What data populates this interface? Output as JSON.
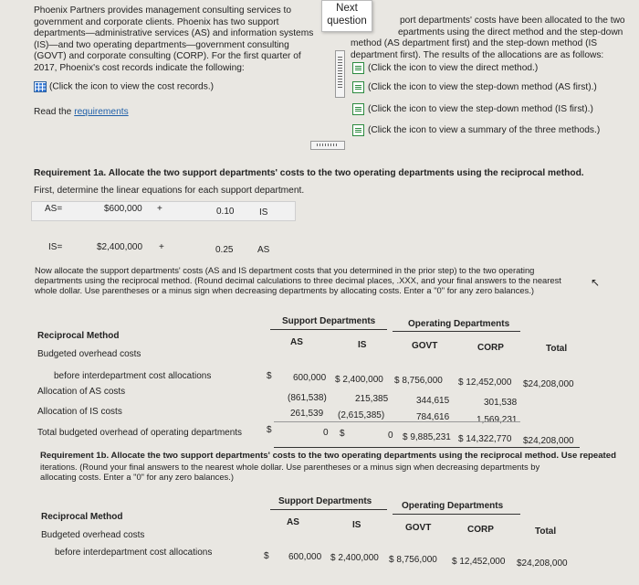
{
  "intro": {
    "left_lines": [
      "Phoenix Partners provides management consulting services to",
      "government and corporate clients. Phoenix has two support",
      "departments—administrative services (AS) and information systems",
      "(IS)—and two operating departments—government consulting",
      "(GOVT) and corporate consulting (CORP). For the first quarter of",
      "2017, Phoenix's cost records indicate the following:"
    ],
    "cost_records_link": "(Click the icon to view the cost records.)",
    "read_the": "Read the",
    "requirements_link": "requirements",
    "right_lines": [
      "port departments' costs have been allocated to the two",
      "epartments using the direct method and the step-down",
      "method (AS department first) and the step-down method (IS",
      "department first). The results of the allocations are as follows:"
    ],
    "links": [
      "(Click the icon to view the direct method.)",
      "(Click the icon to view the step-down method (AS first).)",
      "(Click the icon to view the step-down method (IS first).)",
      "(Click the icon to view a summary of the three methods.)"
    ]
  },
  "next_question": {
    "line1": "Next",
    "line2": "question"
  },
  "req1a": {
    "title": "Requirement 1a. Allocate the two support departments' costs to the two operating departments using the reciprocal method.",
    "subtitle": "First, determine the linear equations for each support department.",
    "eq_as": {
      "label": "AS=",
      "amount": "$600,000",
      "plus": "+",
      "coef": "0.10",
      "var": "IS"
    },
    "eq_is": {
      "label": "IS=",
      "amount": "$2,400,000",
      "plus": "+",
      "coef": "0.25",
      "var": "AS"
    },
    "instructions": [
      "Now allocate the support departments' costs (AS and IS department costs that you determined in the prior step) to the two operating",
      "departments using the reciprocal method. (Round decimal calculations to three decimal places, .XXX, and your final answers to the nearest",
      "whole dollar. Use parentheses or a minus sign when decreasing departments by allocating costs. Enter a \"0\" for any zero balances.)"
    ]
  },
  "table1": {
    "group_support": "Support Departments",
    "group_operating": "Operating Departments",
    "method": "Reciprocal Method",
    "cols": [
      "AS",
      "IS",
      "GOVT",
      "CORP",
      "Total"
    ],
    "rows": [
      {
        "label": "Budgeted overhead costs",
        "cells": [
          "",
          "",
          "",
          "",
          ""
        ]
      },
      {
        "label": "before interdepartment cost allocations",
        "dollar": "$",
        "cells": [
          "600,000",
          "$ 2,400,000",
          "$ 8,756,000",
          "$ 12,452,000",
          "$24,208,000"
        ]
      },
      {
        "label": "Allocation of AS costs",
        "cells": [
          "(861,538)",
          "215,385",
          "344,615",
          "301,538",
          ""
        ]
      },
      {
        "label": "Allocation of IS costs",
        "cells": [
          "261,539",
          "(2,615,385)",
          "784,616",
          "1,569,231",
          ""
        ]
      },
      {
        "label": "Total budgeted overhead of operating departments",
        "dollar": "$",
        "cells": [
          "0",
          "$",
          "0",
          "$ 9,885,231",
          "$ 14,322,770",
          "$24,208,000"
        ]
      }
    ]
  },
  "req1b": {
    "title": "Requirement 1b. Allocate the two support departments' costs to the two operating departments using the reciprocal method. Use repeated",
    "lines": [
      "iterations. (Round your final answers to the nearest whole dollar. Use parentheses or a minus sign when decreasing departments by",
      "allocating costs. Enter a \"0\" for any zero balances.)"
    ]
  },
  "table2": {
    "group_support": "Support Departments",
    "group_operating": "Operating Departments",
    "method": "Reciprocal Method",
    "cols": [
      "AS",
      "IS",
      "GOVT",
      "CORP",
      "Total"
    ],
    "rows": [
      {
        "label": "Budgeted overhead costs"
      },
      {
        "label": "before interdepartment cost allocations",
        "dollar": "$",
        "cells": [
          "600,000",
          "$ 2,400,000",
          "$ 8,756,000",
          "$ 12,452,000",
          "$24,208,000"
        ]
      }
    ]
  }
}
